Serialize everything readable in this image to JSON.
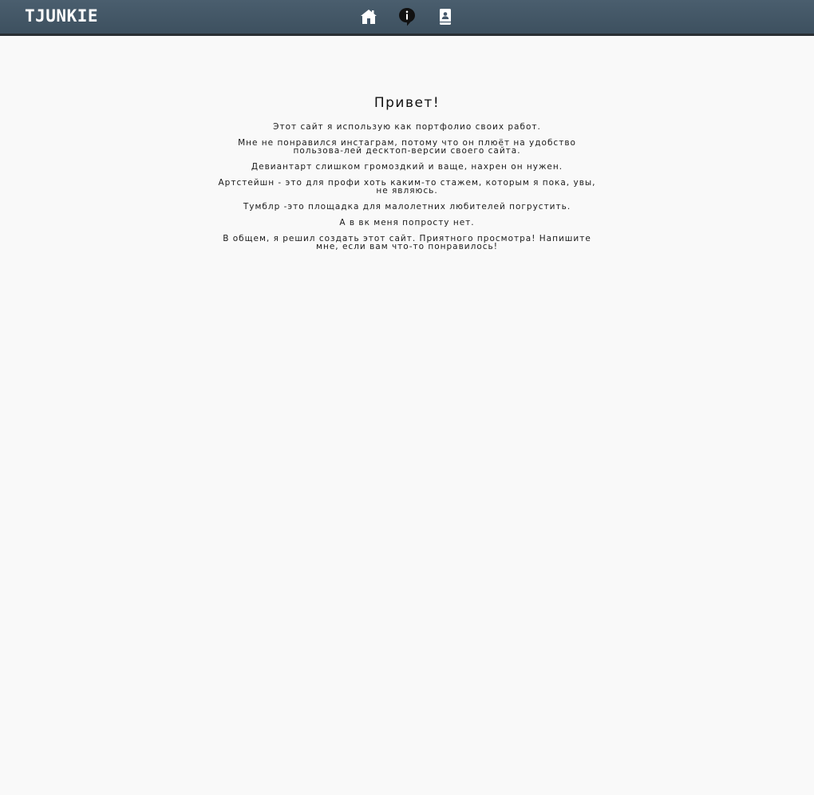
{
  "header": {
    "logo": "TJUNKIE",
    "nav": [
      {
        "icon": "home-icon"
      },
      {
        "icon": "info-bubble-icon"
      },
      {
        "icon": "contact-book-icon"
      }
    ],
    "colors": {
      "bar": "#44576a",
      "bar_border": "#2a2f34",
      "icon": "#ffffff"
    }
  },
  "main": {
    "title": "Привет!",
    "paragraphs": [
      "Этот сайт я использую как портфолио своих работ.",
      "Мне не понравился инстаграм, потому что он плюёт на удобство пользова-лей десктоп-версии своего сайта.",
      "Девиантарт слишком громоздкий и ваще, нахрен он нужен.",
      "Артстейшн - это для профи хоть каким-то стажем, которым я пока, увы, не являюсь.",
      "Тумблр -это площадка для малолетних любителей погрустить.",
      "А в вк меня попросту нет.",
      "В общем, я решил создать этот сайт. Приятного просмотра! Напишите мне, если вам что-то понравилось!"
    ]
  }
}
